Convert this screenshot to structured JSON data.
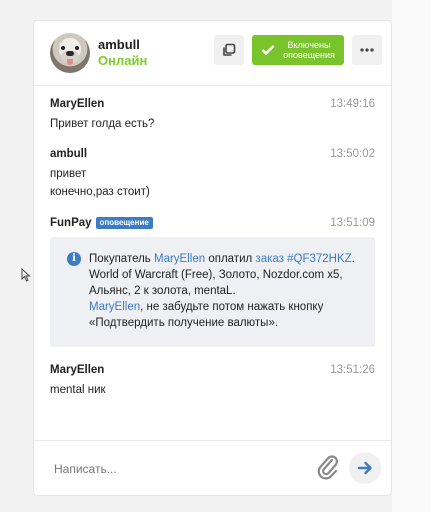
{
  "header": {
    "user_name": "ambull",
    "user_status": "Онлайн",
    "notifications_label": "Включены\nоповещения"
  },
  "messages": [
    {
      "author": "MaryEllen",
      "time": "13:49:16",
      "lines": [
        "Привет голда есть?"
      ]
    },
    {
      "author": "ambull",
      "time": "13:50:02",
      "lines": [
        "привет",
        "конечно,раз стоит)"
      ]
    },
    {
      "author": "FunPay",
      "badge": "оповещение",
      "time": "13:51:09"
    },
    {
      "author": "MaryEllen",
      "time": "13:51:26",
      "lines": [
        "mental ник"
      ]
    }
  ],
  "system_notice": {
    "part1": "Покупатель ",
    "buyer": "MaryEllen",
    "part2": " оплатил ",
    "order_link": "заказ #QF372HKZ",
    "part3": ". World of Warcraft (Free), Золото, Nozdor.com x5, Альянс, 2 к золота, mentaL.",
    "buyer2": "MaryEllen",
    "part4": ", не забудьте потом нажать кнопку «Подтвердить получение валюты»."
  },
  "input": {
    "placeholder": "Написать..."
  },
  "colors": {
    "online": "#7ccf2b",
    "accent_green": "#79c42a",
    "link_blue": "#3c7cc4"
  },
  "icons": [
    "copy-icon",
    "check-icon",
    "more-icon",
    "info-icon",
    "paperclip-icon",
    "send-arrow-icon",
    "mouse-cursor-icon"
  ]
}
